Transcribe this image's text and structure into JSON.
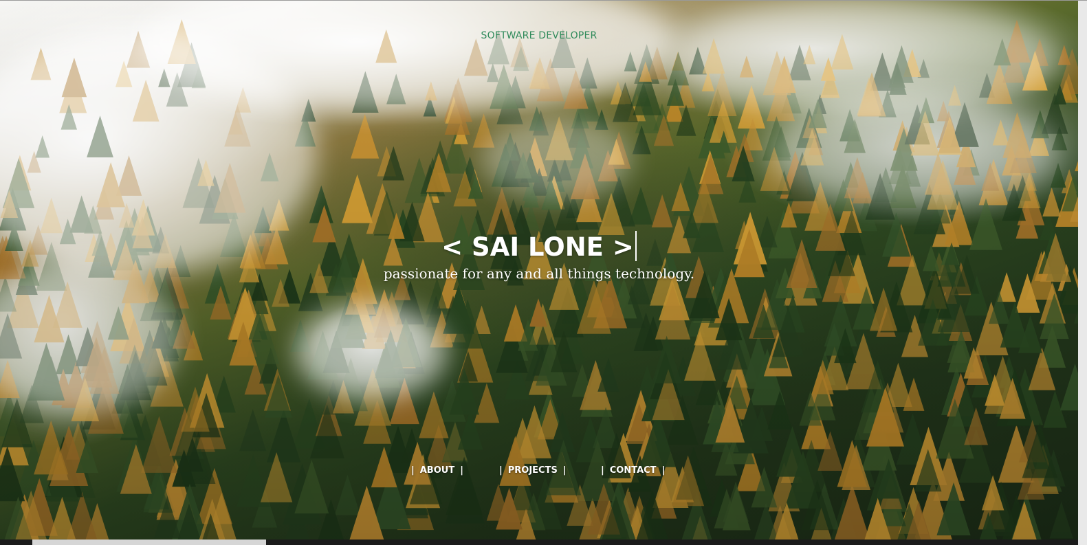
{
  "hero": {
    "top_label": "SOFTWARE DEVELOPER",
    "name": "< SAI LONE >",
    "tagline": "passionate for any and all things technology."
  },
  "nav": {
    "separator": "|",
    "items": [
      {
        "label": "ABOUT"
      },
      {
        "label": "PROJECTS"
      },
      {
        "label": "CONTACT"
      }
    ]
  },
  "colors": {
    "accent_green": "#2f8a5a",
    "text_light": "#ffffff"
  },
  "background": {
    "description_icon": "forest-mist-image"
  }
}
